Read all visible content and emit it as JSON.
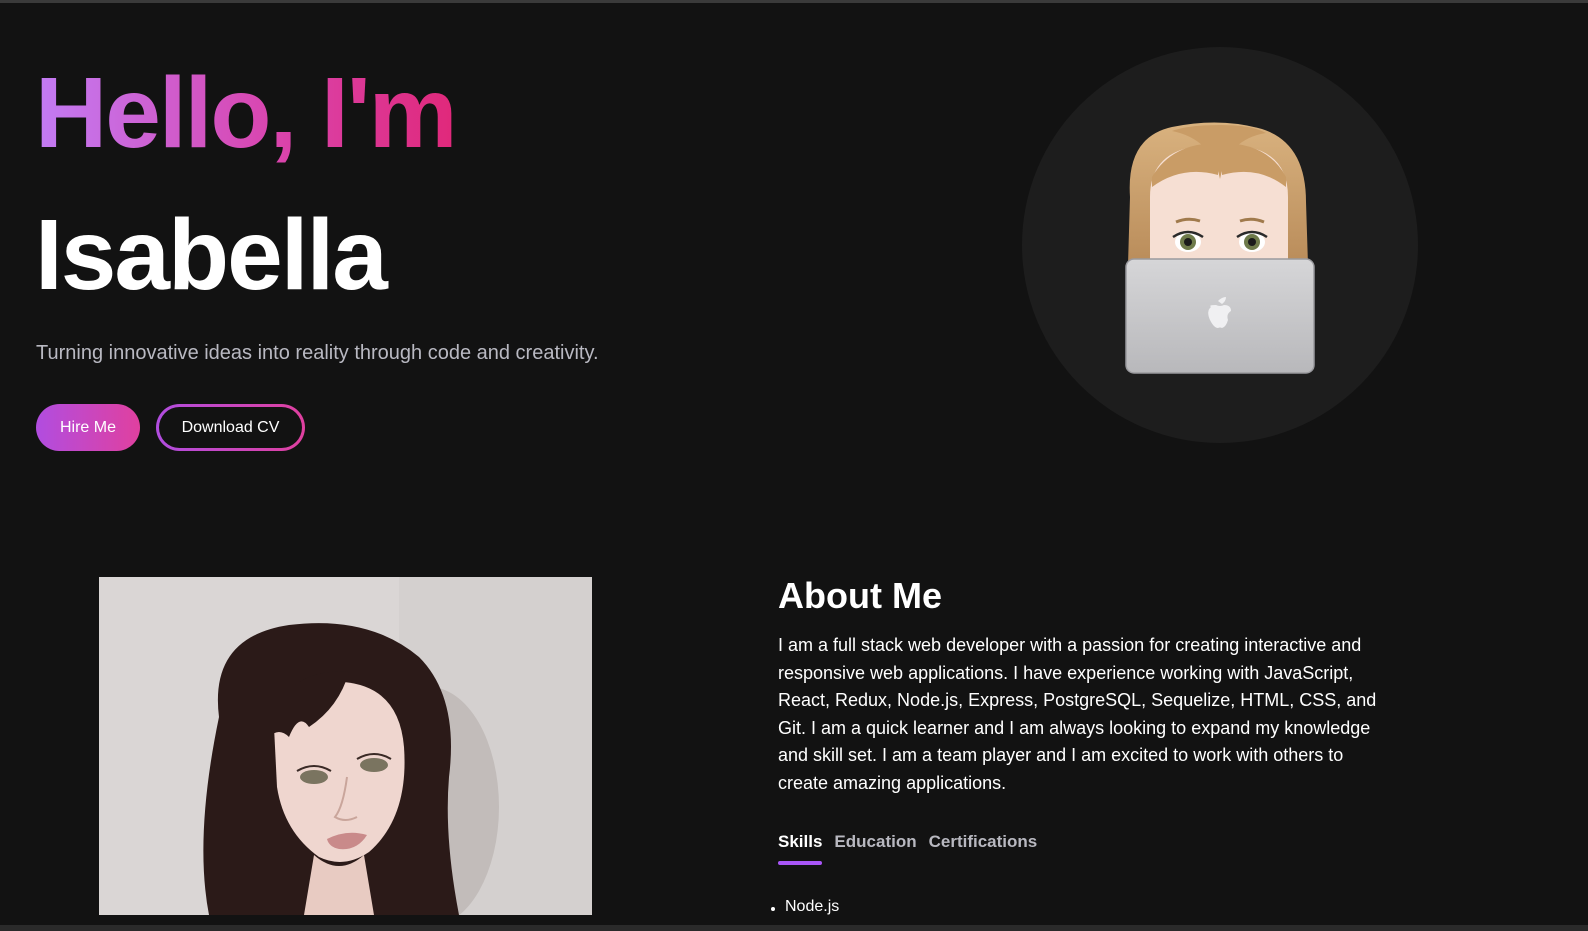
{
  "hero": {
    "greeting": "Hello, I'm",
    "name": "Isabella",
    "tagline": "Turning innovative ideas into reality through code and creativity.",
    "hire_label": "Hire Me",
    "cv_label": "Download CV"
  },
  "about": {
    "title": "About Me",
    "text": "I am a full stack web developer with a passion for creating interactive and responsive web applications. I have experience working with JavaScript, React, Redux, Node.js, Express, PostgreSQL, Sequelize, HTML, CSS, and Git. I am a quick learner and I am always looking to expand my knowledge and skill set. I am a team player and I am excited to work with others to create amazing applications.",
    "tabs": [
      {
        "label": "Skills",
        "active": true
      },
      {
        "label": "Education",
        "active": false
      },
      {
        "label": "Certifications",
        "active": false
      }
    ],
    "skills": [
      "Node.js"
    ]
  },
  "colors": {
    "background": "#121212",
    "accent_start": "#b14de0",
    "accent_end": "#e0409f",
    "tab_underline": "#a855f7"
  },
  "icons": {
    "avatar": "memoji-laptop-icon",
    "laptop_logo": "apple-logo-icon"
  }
}
